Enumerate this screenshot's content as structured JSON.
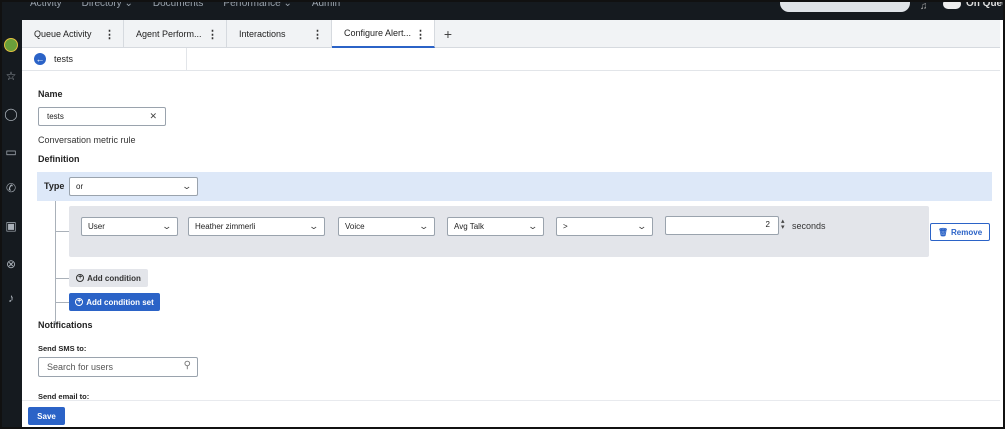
{
  "top_nav": {
    "menu": [
      "Activity",
      "Directory ⌄",
      "Documents",
      "Performance ⌄",
      "Admin"
    ],
    "status": "On Queue"
  },
  "tabs": [
    {
      "label": "Queue Activity"
    },
    {
      "label": "Agent Perform..."
    },
    {
      "label": "Interactions"
    },
    {
      "label": "Configure Alert..."
    }
  ],
  "add_tab_label": "+",
  "breadcrumb": {
    "label": "tests"
  },
  "form": {
    "name_label": "Name",
    "name_value": "tests",
    "rule_type_text": "Conversation metric rule",
    "definition_label": "Definition",
    "type_label": "Type",
    "type_value": "or",
    "condition": {
      "entity": "User",
      "user": "Heather zimmerli",
      "media": "Voice",
      "metric": "Avg Talk",
      "operator": ">",
      "value": "2",
      "unit": "seconds"
    },
    "remove_label": "Remove",
    "add_condition_label": "Add condition",
    "add_condition_set_label": "Add condition set",
    "notifications_label": "Notifications",
    "sms_label": "Send SMS to:",
    "sms_placeholder": "Search for users",
    "email_label": "Send email to:"
  },
  "footer": {
    "save_label": "Save"
  },
  "colors": {
    "accent": "#2b63c7",
    "typebar": "#dde8f8",
    "condition_bg": "#e3e5ea"
  }
}
